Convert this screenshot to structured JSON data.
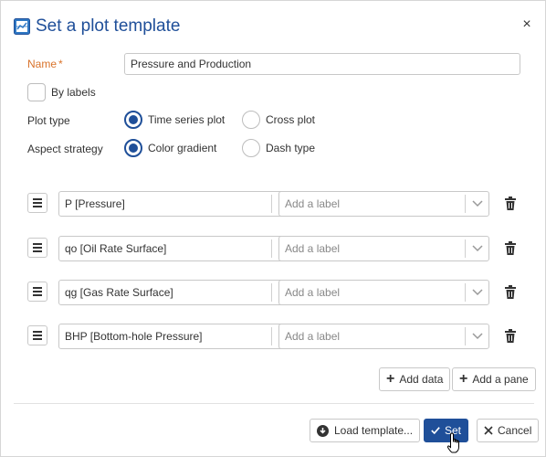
{
  "dialog": {
    "title": "Set a plot template",
    "close_label": "×"
  },
  "form": {
    "name_label": "Name",
    "name_required_mark": "*",
    "name_value": "Pressure and Production",
    "by_labels_label": "By labels",
    "by_labels_checked": false,
    "plot_type_label": "Plot type",
    "plot_type_options": [
      "Time series plot",
      "Cross plot"
    ],
    "plot_type_selected": "Time series plot",
    "aspect_label": "Aspect strategy",
    "aspect_options": [
      "Color gradient",
      "Dash type"
    ],
    "aspect_selected": "Color gradient"
  },
  "rows": [
    {
      "data": "P [Pressure]",
      "label_placeholder": "Add a label"
    },
    {
      "data": "qo [Oil Rate Surface]",
      "label_placeholder": "Add a label"
    },
    {
      "data": "qg [Gas Rate Surface]",
      "label_placeholder": "Add a label"
    },
    {
      "data": "BHP [Bottom-hole Pressure]",
      "label_placeholder": "Add a label"
    }
  ],
  "actions": {
    "add_data": "Add data",
    "add_pane": "Add a pane",
    "load_template": "Load template...",
    "set": "Set",
    "cancel": "Cancel"
  },
  "colors": {
    "accent": "#1f4f99",
    "required_label": "#d9732b"
  },
  "icons": [
    "app-template-icon",
    "close-icon",
    "drag-handle-icon",
    "chevron-down-icon",
    "trash-icon",
    "plus-icon",
    "download-circle-icon",
    "check-icon",
    "x-icon",
    "hand-cursor-icon"
  ]
}
